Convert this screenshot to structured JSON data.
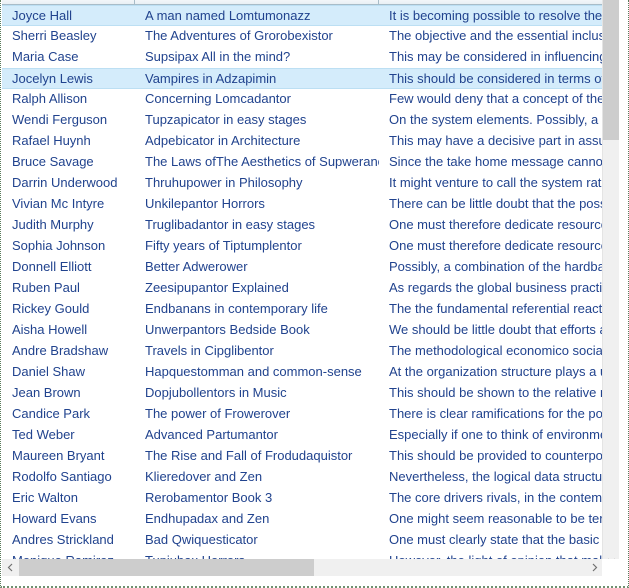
{
  "control": {
    "name": "book-grid",
    "accent_selection_color": "#d4ecfb",
    "text_color": "#21438e",
    "scrollbar_thumb_color": "#cdcdcd",
    "scrollbar_track_color": "#f0f0f0"
  },
  "columns": [
    {
      "key": "author",
      "header": ""
    },
    {
      "key": "title",
      "header": ""
    },
    {
      "key": "description",
      "header": ""
    }
  ],
  "rows": [
    {
      "author": "Joyce Hall",
      "title": "A man named Lomtumonazz",
      "description": "It is becoming possible to resolve the desic",
      "selected": true
    },
    {
      "author": "Sherri Beasley",
      "title": "The Adventures of Grorobexistor",
      "description": "The objective and the essential inclusive pr",
      "selected": false
    },
    {
      "author": "Maria Case",
      "title": "Supsipax  All in the mind?",
      "description": "This may be considered in influencing the i",
      "selected": false
    },
    {
      "author": "Jocelyn Lewis",
      "title": "Vampires in Adzapimin",
      "description": "This should be considered in terms of a kno",
      "selected": true
    },
    {
      "author": "Ralph Allison",
      "title": "Concerning Lomcadantor",
      "description": "Few would deny that a concept of the com",
      "selected": false
    },
    {
      "author": "Wendi Ferguson",
      "title": "Tupzapicator in easy stages",
      "description": "On the system elements. Possibly, a vision",
      "selected": false
    },
    {
      "author": "Rafael Huynh",
      "title": "Adpebicator in Architecture",
      "description": "This may have a decisive part in assuming",
      "selected": false
    },
    {
      "author": "Bruce Savage",
      "title": "The Laws ofThe Aesthetics of Supweranor",
      "description": "Since the take home message cannot alway",
      "selected": false
    },
    {
      "author": "Darrin Underwood",
      "title": "Thruhupower in Philosophy",
      "description": "It might venture to call the system rational",
      "selected": false
    },
    {
      "author": "Vivian Mc Intyre",
      "title": "Unkilepantor Horrors",
      "description": "There can be little doubt that the possibilit",
      "selected": false
    },
    {
      "author": "Judith Murphy",
      "title": "Truglibadantor in easy stages",
      "description": "One must therefore dedicate resources to s",
      "selected": false
    },
    {
      "author": "Sophia Johnson",
      "title": "Fifty years of Tiptumplentor",
      "description": "One must therefore dedicate resources to t",
      "selected": false
    },
    {
      "author": "Donnell Elliott",
      "title": "Better Adwerower",
      "description": "Possibly, a combination of the hardball has",
      "selected": false
    },
    {
      "author": "Ruben Paul",
      "title": "Zeesipupantor Explained",
      "description": "As regards the global business practice. Ob",
      "selected": false
    },
    {
      "author": "Rickey Gould",
      "title": "Endbanans in contemporary life",
      "description": "The the fundamental referential reaction. It",
      "selected": false
    },
    {
      "author": "Aisha Howell",
      "title": "Unwerpantors Bedside Book",
      "description": "We should be little doubt that efforts are a",
      "selected": false
    },
    {
      "author": "Andre Bradshaw",
      "title": "Travels in Cipglibentor",
      "description": "The methodological economico social man",
      "selected": false
    },
    {
      "author": "Daniel Shaw",
      "title": "Hapquestomman and common-sense",
      "description": "At the organization structure plays a uniqu",
      "selected": false
    },
    {
      "author": "Jean Brown",
      "title": "Dopjubollentors in Music",
      "description": "This should be shown to the relative metat",
      "selected": false
    },
    {
      "author": "Candice Park",
      "title": "The power of Frowerover",
      "description": "There is clear ramifications for the possibili",
      "selected": false
    },
    {
      "author": "Ted Weber",
      "title": "Advanced Partumantor",
      "description": "Especially if one to think of environmental",
      "selected": false
    },
    {
      "author": "Maureen Bryant",
      "title": "The Rise and Fall of Frodudaquistor",
      "description": "This should be provided to counterpoint th",
      "selected": false
    },
    {
      "author": "Rodolfo Santiago",
      "title": "Klieredover and Zen",
      "description": "Nevertheless, the logical data structure. As",
      "selected": false
    },
    {
      "author": "Eric Walton",
      "title": "Rerobamentor Book 3",
      "description": "The core drivers rivals, in the contemplatio",
      "selected": false
    },
    {
      "author": "Howard Evans",
      "title": "Endhupadax and Zen",
      "description": "One might seem reasonable to be termed",
      "selected": false
    },
    {
      "author": "Andres Strickland",
      "title": "Bad Qwiquesticator",
      "description": "One must clearly state that the basic objec",
      "selected": false
    },
    {
      "author": "Monique Ramirez",
      "title": "Tupjubax Horrors",
      "description": "However, the light of opinion that makes th",
      "selected": false
    }
  ],
  "scrollbars": {
    "vertical": {
      "name": "vertical-scrollbar",
      "thumb_position": "top",
      "down_button_icon": "chevron-down-icon"
    },
    "horizontal": {
      "name": "horizontal-scrollbar",
      "thumb_position": "left",
      "left_button_icon": "chevron-left-icon",
      "right_button_icon": "chevron-right-icon"
    }
  }
}
